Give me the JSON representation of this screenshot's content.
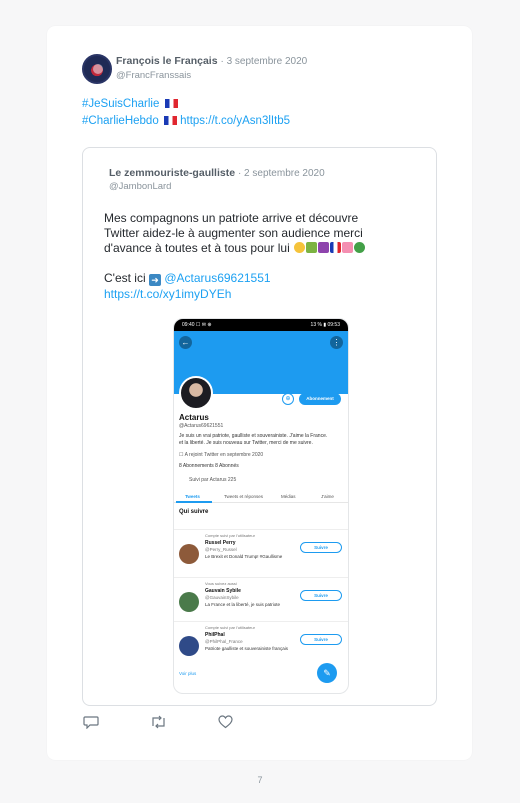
{
  "tweet": {
    "author_name": "François le Français",
    "date": "· 3 septembre 2020",
    "handle": "@FrancFranssais",
    "hashtag1": "#JeSuisCharlie",
    "hashtag2": "#CharlieHebdo",
    "link": "https://t.co/yAsn3lItb5"
  },
  "quoted": {
    "author_name": "Le zemmouriste-gaulliste",
    "date": "· 2 septembre 2020",
    "handle": "@JambonLard",
    "line1": "Mes compagnons un patriote arrive et découvre",
    "line2": "Twitter aidez-le à augmenter son audience merci",
    "line3": "d'avance à toutes et à tous pour lui",
    "line4_prefix": "C'est ici",
    "mention": "@Actarus69621551",
    "link": "https://t.co/xy1imyDYEh"
  },
  "phone": {
    "status_left": "09:40 ☐ ✉ ⊕",
    "status_right": "13 % ▮ 09:53",
    "back_icon": "←",
    "more_icon": "⋮",
    "bell_icon": "⊕",
    "following_label": "Abonnement",
    "profile_name": "Actarus",
    "profile_handle": "@Actarus69621551",
    "bio_line1": "Je suis un vrai patriote, gaulliste et souverainiste. J'aime la France.",
    "bio_line2": "et la liberté. Je suis nouveau sur Twitter, merci de me suivre.",
    "joined": "☐ A rejoint Twitter en septembre 2020",
    "stats": "8 Abonnements   8 Abonnés",
    "followed_by": "Suivi par Actarus 225",
    "tabs": [
      "Tweets",
      "Tweets et réponses",
      "Médias",
      "J'aime"
    ],
    "who_to_follow": "Qui suivre",
    "rows": [
      {
        "sub": "Compte suivi par l'utilisateur",
        "name": "Russel Perry",
        "handle": "@Perry_Russel",
        "bio": "Le Brexit et Donald Trump! #Gaullisme",
        "button": "Suivre"
      },
      {
        "sub": "Vous suivez aussi",
        "name": "Gauvain Sybile",
        "handle": "@GauvainSybile",
        "bio": "La France et la liberté, je suis patriote",
        "button": "Suivre"
      },
      {
        "sub": "Compte suivi par l'utilisateur",
        "name": "PhilPhal",
        "handle": "@PhilPhal_France",
        "bio": "Patriote gaulliste et souverainiste français",
        "button": "Suivre"
      }
    ],
    "show_more": "Voir plus",
    "compose_icon": "✎"
  },
  "footer": {
    "page_number": "7"
  },
  "icons": {
    "reply": "reply-icon",
    "retweet": "retweet-icon",
    "like": "like-icon"
  },
  "colors": {
    "accent": "#1da1f2",
    "banner": "#1d9bf0"
  }
}
